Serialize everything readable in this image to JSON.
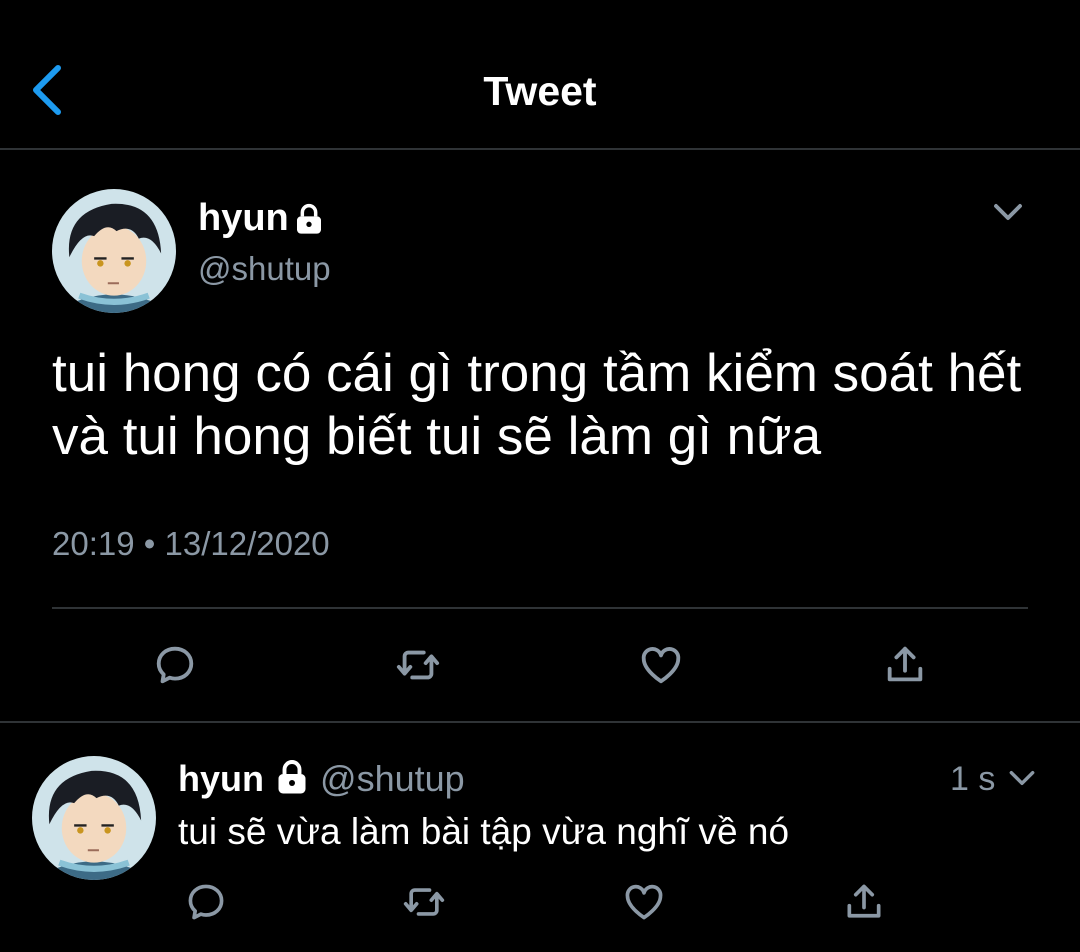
{
  "header": {
    "title": "Tweet",
    "back_icon": "chevron-left-icon",
    "accent": "#1d9bf0"
  },
  "main_tweet": {
    "name": "hyun",
    "handle": "@shutup",
    "protected_icon": "lock-icon",
    "text": "tui hong có cái gì trong tầm kiểm soát hết và tui hong biết tui sẽ làm gì nữa",
    "time": "20:19",
    "separator": "•",
    "date": "13/12/2020",
    "actions": [
      "reply-icon",
      "retweet-icon",
      "like-icon",
      "share-icon"
    ]
  },
  "reply": {
    "name": "hyun",
    "handle": "@shutup",
    "protected_icon": "lock-icon",
    "age": "1 s",
    "text": "tui sẽ vừa làm bài tập vừa nghĩ về nó",
    "actions": [
      "reply-icon",
      "retweet-icon",
      "like-icon",
      "share-icon"
    ]
  },
  "colors": {
    "background": "#000000",
    "text": "#ffffff",
    "secondary": "#8b98a5",
    "divider": "#2f3336"
  }
}
